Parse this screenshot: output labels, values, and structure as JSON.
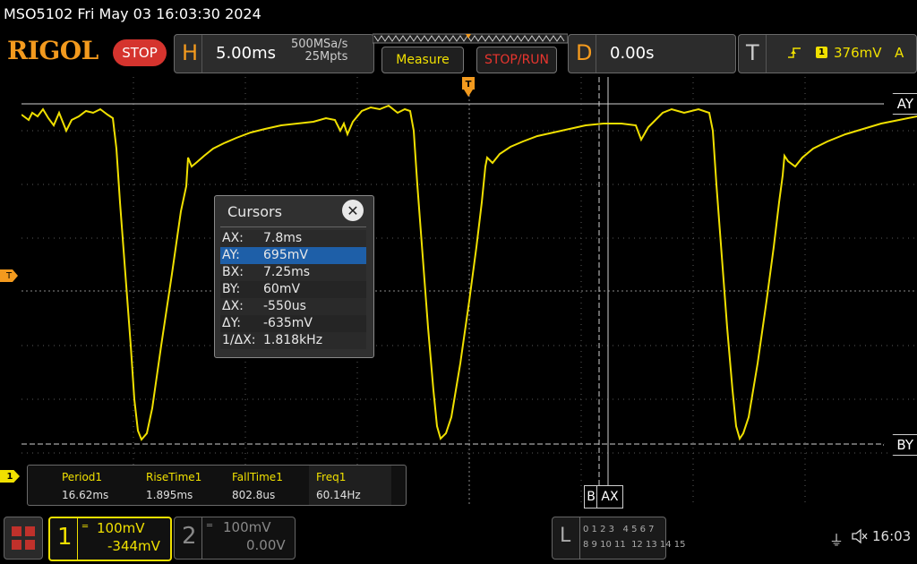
{
  "header": {
    "model_datetime": "MSO5102  Fri May 03 16:03:30 2024",
    "brand": "RIGOL",
    "run_state": "STOP"
  },
  "horizontal": {
    "letter": "H",
    "timebase": "5.00ms",
    "sample_rate": "500MSa/s",
    "memory_depth": "25Mpts"
  },
  "buttons": {
    "measure": "Measure",
    "stop_run": "STOP/RUN"
  },
  "delay": {
    "letter": "D",
    "value": "0.00s"
  },
  "trigger": {
    "letter": "T",
    "source": "1",
    "level": "376mV",
    "mode": "A"
  },
  "markers": {
    "trigger_level": "T",
    "channel1": "1",
    "ay": "AY",
    "by": "BY",
    "ax": "AX",
    "bx": "B"
  },
  "cursors_menu": {
    "title": "Cursors",
    "rows": [
      {
        "key": "AX:",
        "value": "7.8ms"
      },
      {
        "key": "AY:",
        "value": "695mV"
      },
      {
        "key": "BX:",
        "value": "7.25ms"
      },
      {
        "key": "BY:",
        "value": "60mV"
      },
      {
        "key": "ΔX:",
        "value": "-550us"
      },
      {
        "key": "ΔY:",
        "value": "-635mV"
      },
      {
        "key": "1/ΔX:",
        "value": "1.818kHz"
      }
    ],
    "selected_row_index": 1
  },
  "measurements": [
    {
      "name": "Period1",
      "value": "16.62ms"
    },
    {
      "name": "RiseTime1",
      "value": "1.895ms"
    },
    {
      "name": "FallTime1",
      "value": "802.8us"
    },
    {
      "name": "Freq1",
      "value": "60.14Hz"
    }
  ],
  "channel1": {
    "number": "1",
    "scale": "100mV",
    "offset": "-344mV",
    "color": "#f0e000"
  },
  "channel2": {
    "number": "2",
    "scale": "100mV",
    "offset": "0.00V"
  },
  "logic": {
    "letter": "L",
    "row1": "0 1 2 3   4 5 6 7",
    "row2": "8 9 10 11  12 13 14 15"
  },
  "status": {
    "time": "16:03"
  },
  "colors": {
    "accent_orange": "#f39a1e",
    "stop_red": "#d5342e",
    "trace_yellow": "#f0e000",
    "selected_blue": "#1e5fa8"
  }
}
